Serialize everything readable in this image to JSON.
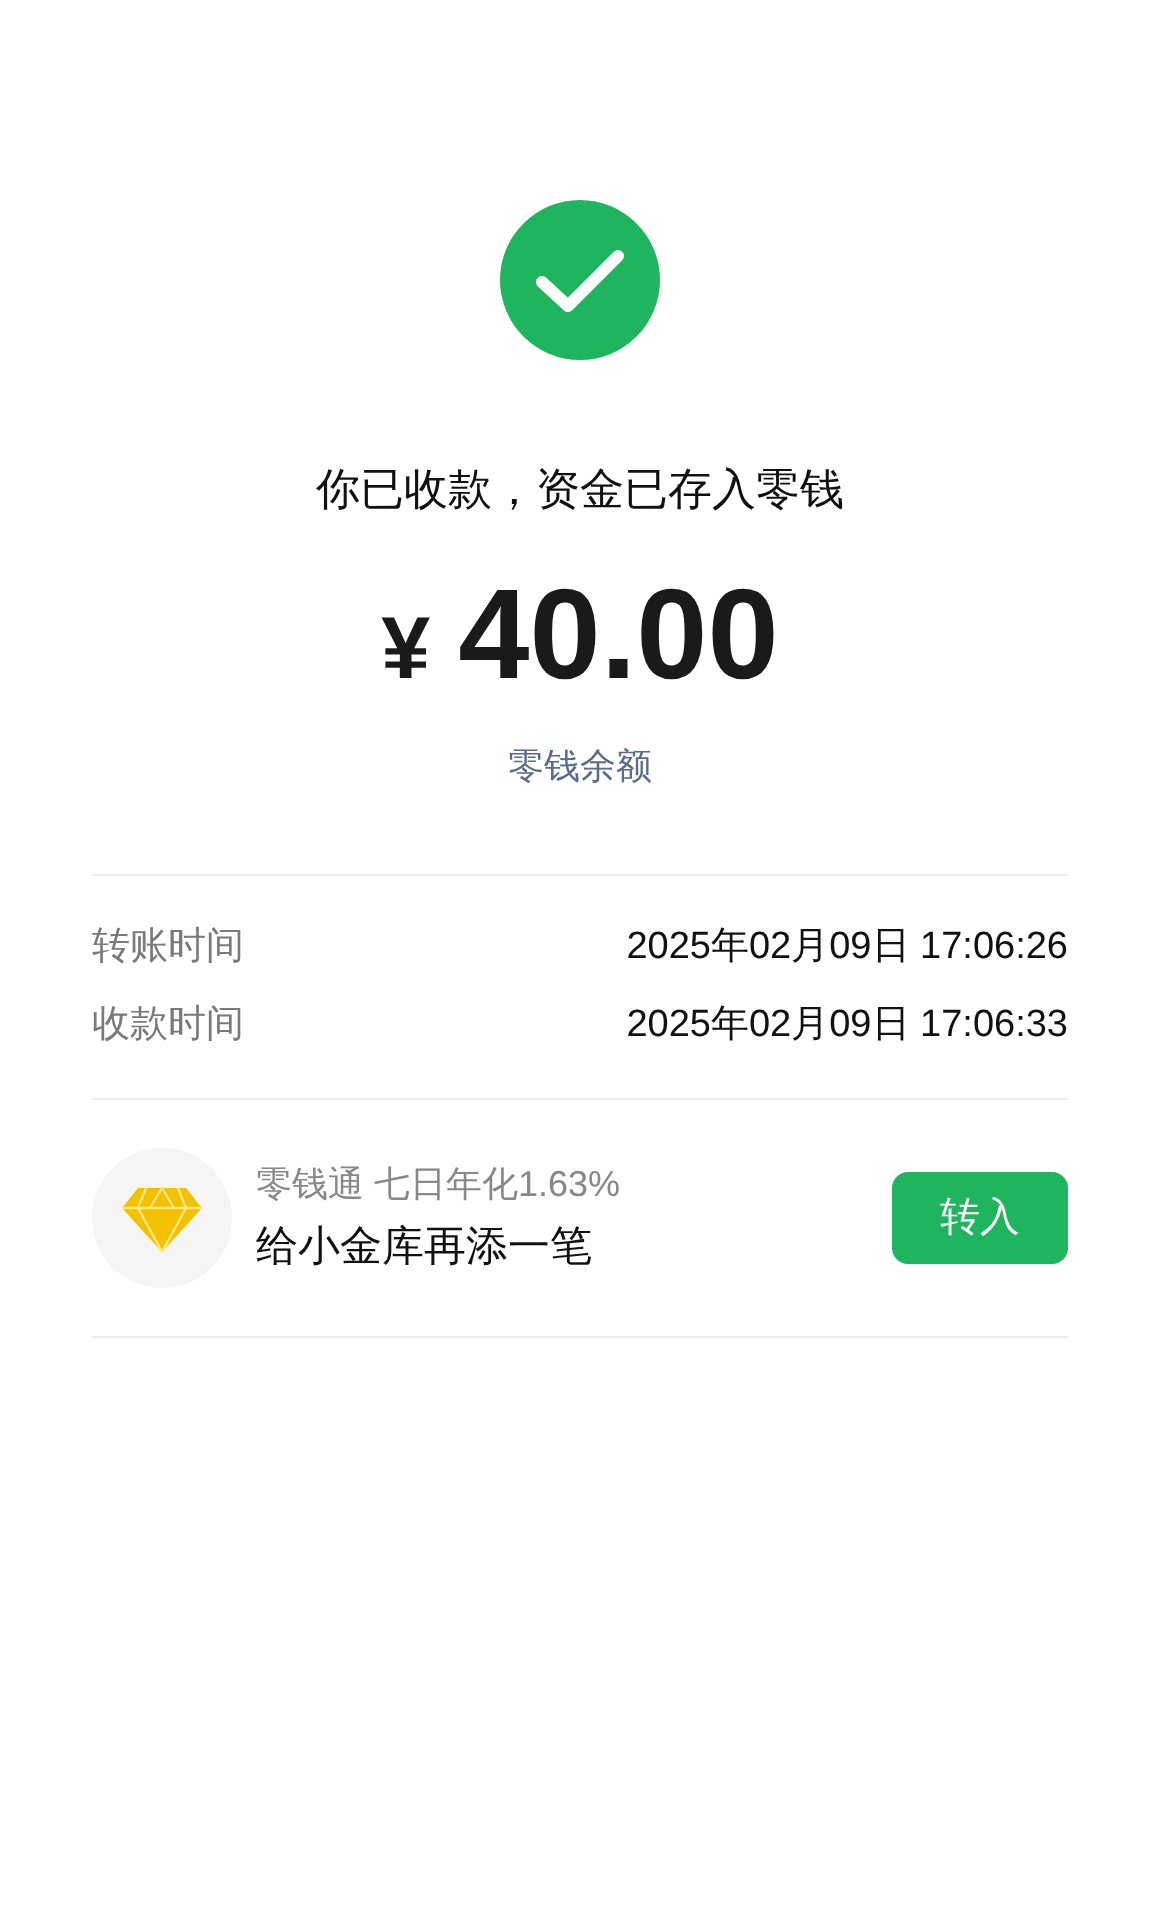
{
  "status": {
    "message": "你已收款，资金已存入零钱",
    "currency": "¥",
    "amount": "40.00",
    "balance_link": "零钱余额"
  },
  "details": [
    {
      "label": "转账时间",
      "value": "2025年02月09日 17:06:26"
    },
    {
      "label": "收款时间",
      "value": "2025年02月09日 17:06:33"
    }
  ],
  "promo": {
    "subtitle": "零钱通 七日年化1.63%",
    "title": "给小金库再添一笔",
    "button": "转入"
  }
}
